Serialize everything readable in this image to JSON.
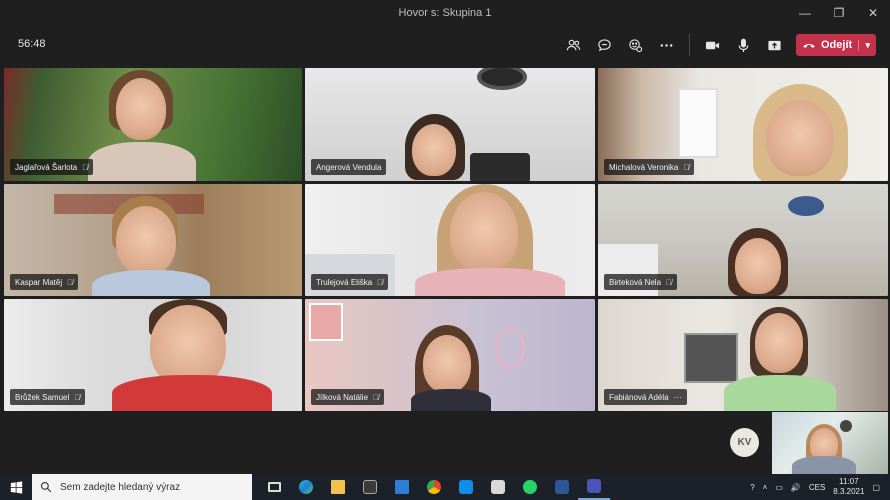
{
  "window": {
    "title": "Hovor s: Skupina 1",
    "controls": [
      "—",
      "❐",
      "✕"
    ]
  },
  "toolbar": {
    "timer": "56:48",
    "buttons": [
      "show-participants",
      "show-chat",
      "reactions",
      "more-actions",
      "camera",
      "microphone",
      "share"
    ],
    "leave_label": "Odejít"
  },
  "participants": [
    {
      "name": "Jaglařová Šarlota",
      "muted": true
    },
    {
      "name": "Angerová Vendula",
      "muted": false
    },
    {
      "name": "Michalová Veronika",
      "muted": true
    },
    {
      "name": "Kaspar Matěj",
      "muted": true
    },
    {
      "name": "Trulejová Eliška",
      "muted": true
    },
    {
      "name": "Birteková Nela",
      "muted": true
    },
    {
      "name": "Brůžek Samuel",
      "muted": true
    },
    {
      "name": "Jílková Natálie",
      "muted": true
    },
    {
      "name": "Fabiánová Adéla",
      "muted": false,
      "more": "···"
    }
  ],
  "self": {
    "initials": "KV"
  },
  "taskbar": {
    "search_placeholder": "Sem zadejte hledaný výraz",
    "apps": [
      "task-view",
      "edge",
      "file-explorer",
      "store",
      "mail",
      "chrome",
      "teamviewer",
      "media",
      "whatsapp",
      "word",
      "teams"
    ],
    "tray": {
      "language": "CES",
      "time": "11:07",
      "date": "8.3.2021"
    }
  },
  "colors": {
    "leave": "#c4314b",
    "teams": "#4b53bc",
    "taskbar": "#1c2029"
  }
}
